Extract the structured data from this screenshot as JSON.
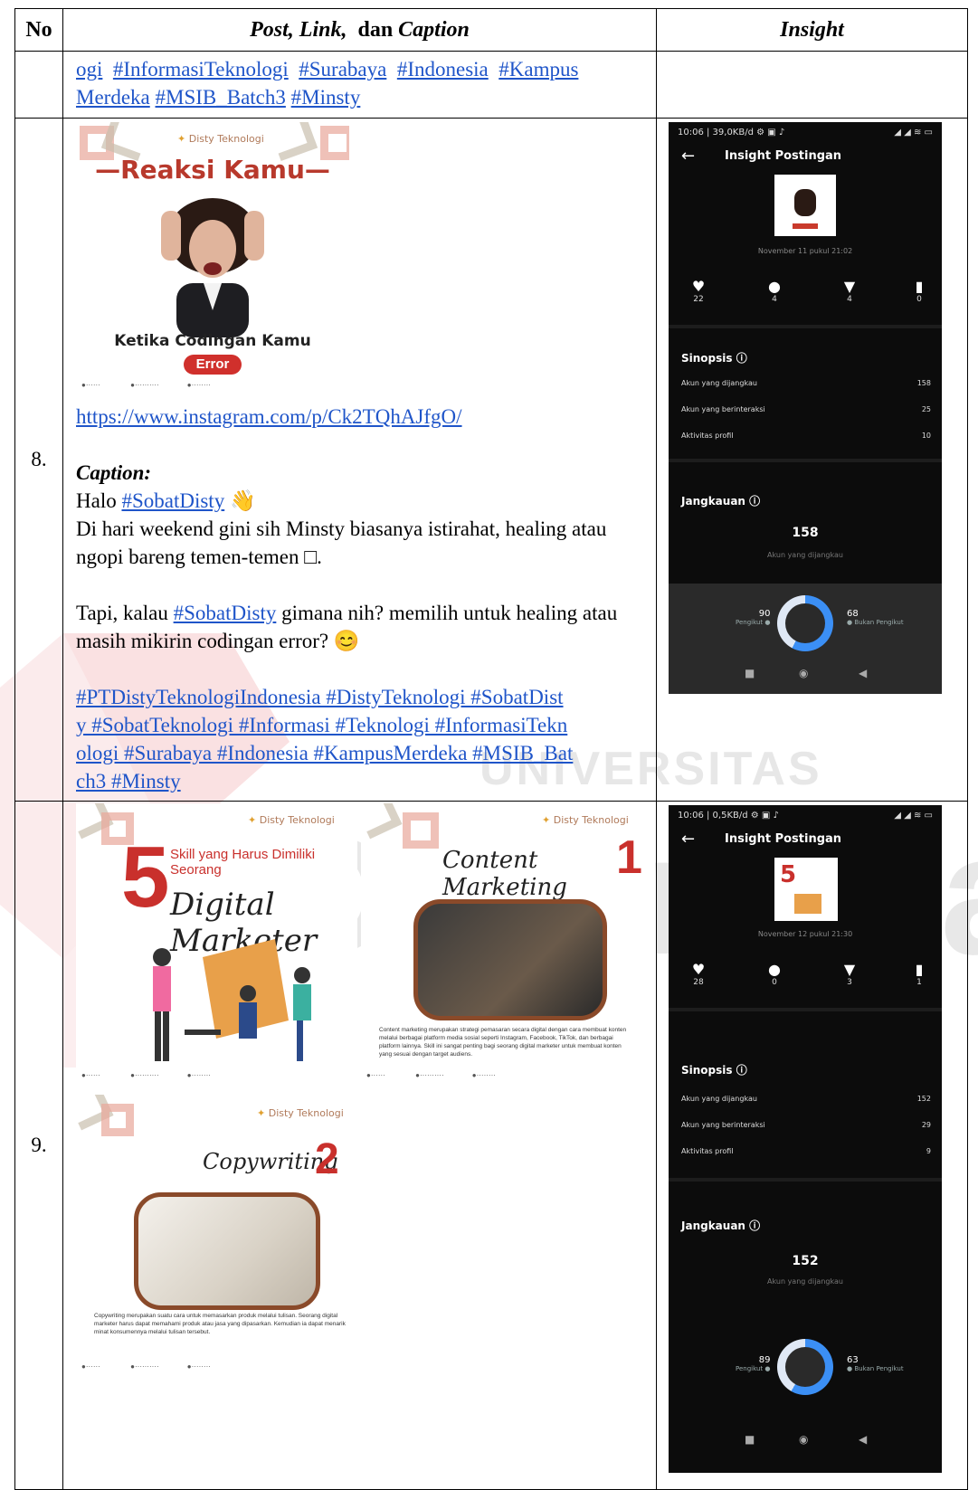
{
  "table": {
    "headers": {
      "no": "No",
      "post_a": "Post, Link,",
      "post_b": "dan",
      "post_c": "Caption",
      "insight": "Insight"
    },
    "continuation_hashtags_line1": [
      "ogi",
      "#InformasiTeknologi",
      "#Surabaya",
      "#Indonesia",
      "#Kampus"
    ],
    "continuation_hashtags_line2": [
      "Merdeka",
      "#MSIB_Batch3",
      "#Minsty"
    ]
  },
  "row8": {
    "number": "8.",
    "post": {
      "brand": "Disty Teknologi",
      "headline": "—Reaksi Kamu—",
      "subline": "Ketika Codingan Kamu",
      "badge": "Error"
    },
    "link": "https://www.instagram.com/p/Ck2TQhAJfgO/",
    "caption_label": "Caption:",
    "greeting_prefix": "Halo ",
    "greeting_tag": "#SobatDisty",
    "greeting_emoji": "👋",
    "para1": "Di hari weekend gini sih Minsty biasanya istirahat, healing atau ngopi bareng temen-temen □.",
    "para2_prefix": "Tapi, kalau ",
    "para2_tag": "#SobatDisty",
    "para2_rest": " gimana nih? memilih untuk healing atau masih mikirin codingan error? 😊",
    "hashtags_l1": "#PTDistyTeknologiIndonesia #DistyTeknologi #SobatDist",
    "hashtags_l2": "y #SobatTeknologi #Informasi #Teknologi #InformasiTekn",
    "hashtags_l3": "ologi #Surabaya #Indonesia #KampusMerdeka #MSIB_Bat",
    "hashtags_l4": "ch3 #Minsty",
    "insight": {
      "status": "10:06 | 39,0KB/d ⚙ ▣ ♪",
      "signal": "◢ ◢ ≋ ▭",
      "title": "Insight Postingan",
      "date": "November 11 pukul 21:02",
      "likes": "22",
      "comments": "4",
      "shares": "4",
      "saves": "0",
      "sinopsis": "Sinopsis ⓘ",
      "rows": [
        {
          "label": "Akun yang dijangkau",
          "value": "158"
        },
        {
          "label": "Akun yang berinteraksi",
          "value": "25"
        },
        {
          "label": "Aktivitas profil",
          "value": "10"
        }
      ],
      "jangkauan": "Jangkauan ⓘ",
      "reach": "158",
      "reach_label": "Akun yang dijangkau",
      "followers": "90",
      "followers_label": "Pengikut ●",
      "nonfollowers": "68",
      "nonfollowers_label": "● Bukan Pengikut"
    }
  },
  "row9": {
    "number": "9.",
    "post1": {
      "brand": "Disty Teknologi",
      "big_number": "5",
      "title": "Skill yang Harus Dimiliki Seorang",
      "script": "Digital Marketer"
    },
    "post2": {
      "brand": "Disty Teknologi",
      "script": "Content Marketing",
      "num": "1",
      "body": "Content marketing merupakan strategi pemasaran secara digital dengan cara membuat konten melalui berbagai platform media sosial seperti Instagram, Facebook, TikTok, dan berbagai platform lainnya. Skill ini sangat penting bagi seorang digital marketer untuk membuat konten yang sesuai dengan target audiens."
    },
    "post3": {
      "brand": "Disty Teknologi",
      "script": "Copywriting",
      "num": "2",
      "body": "Copywriting merupakan suatu cara untuk memasarkan produk melalui tulisan. Seorang digital marketer harus dapat memahami produk atau jasa yang dipasarkan. Kemudian ia dapat menarik minat konsumennya melalui tulisan tersebut."
    },
    "insight": {
      "status": "10:06 | 0,5KB/d ⚙ ▣ ♪",
      "signal": "◢ ◢ ≋ ▭",
      "title": "Insight Postingan",
      "date": "November 12 pukul 21:30",
      "likes": "28",
      "comments": "0",
      "shares": "3",
      "saves": "1",
      "sinopsis": "Sinopsis ⓘ",
      "rows": [
        {
          "label": "Akun yang dijangkau",
          "value": "152"
        },
        {
          "label": "Akun yang berinteraksi",
          "value": "29"
        },
        {
          "label": "Aktivitas profil",
          "value": "9"
        }
      ],
      "jangkauan": "Jangkauan ⓘ",
      "reach": "152",
      "reach_label": "Akun yang dijangkau",
      "followers": "89",
      "followers_label": "Pengikut ●",
      "nonfollowers": "63",
      "nonfollowers_label": "● Bukan Pengikut"
    }
  },
  "watermark": {
    "word1": "UNIVERSITAS",
    "word2": "Dinamika",
    "color_red": "#e0404a",
    "color_gray": "#888888"
  }
}
